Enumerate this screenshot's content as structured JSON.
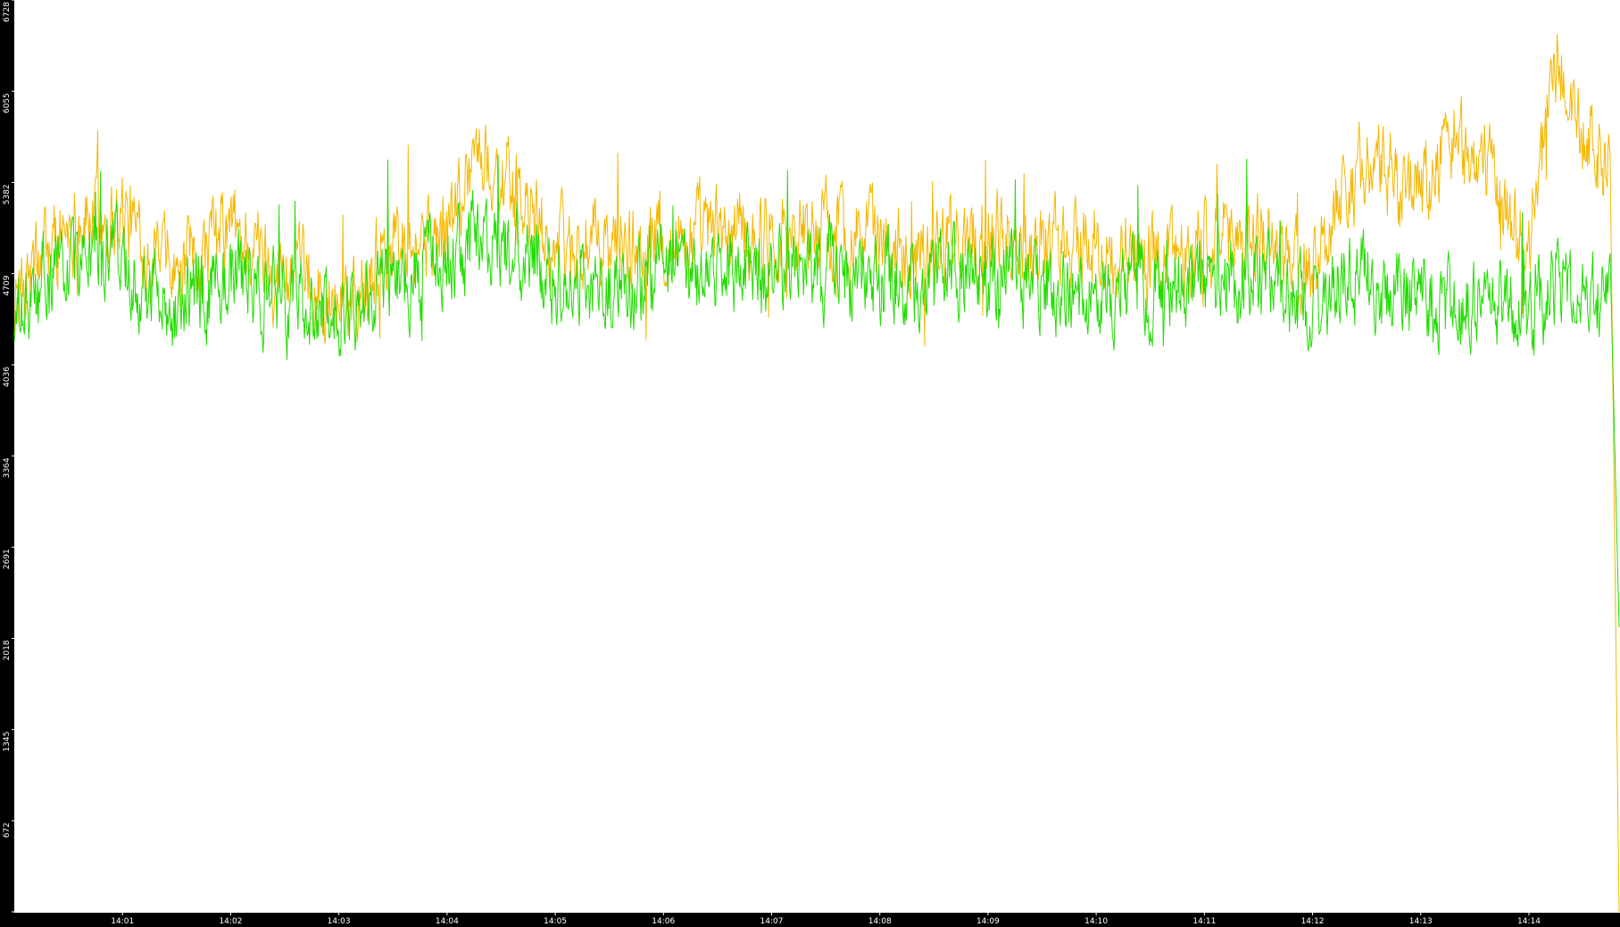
{
  "chart_data": {
    "type": "line",
    "title": "",
    "xlabel": "",
    "ylabel": "",
    "ylim": [
      0,
      6728
    ],
    "y_ticks": [
      "0",
      "672",
      "1345",
      "2018",
      "2691",
      "3364",
      "4036",
      "4709",
      "5382",
      "6055",
      "6728"
    ],
    "x_range": [
      "14:00:00",
      "14:14:50"
    ],
    "x_ticks": [
      "14:01",
      "14:02",
      "14:03",
      "14:04",
      "14:05",
      "14:06",
      "14:07",
      "14:08",
      "14:09",
      "14:10",
      "14:11",
      "14:12",
      "14:13",
      "14:14"
    ],
    "grid": false,
    "legend": "none",
    "background": "#ffffff",
    "axis_bar_color": "#000000",
    "series": [
      {
        "color": "#f5b800",
        "x": [
          "14:00",
          "14:00:30",
          "14:01",
          "14:01:30",
          "14:02",
          "14:02:30",
          "14:03",
          "14:03:30",
          "14:04",
          "14:04:15",
          "14:04:30",
          "14:05",
          "14:05:30",
          "14:06",
          "14:06:30",
          "14:07",
          "14:07:30",
          "14:08",
          "14:08:30",
          "14:09",
          "14:09:30",
          "14:10",
          "14:10:30",
          "14:11",
          "14:11:30",
          "14:12",
          "14:12:15",
          "14:12:30",
          "14:13",
          "14:13:15",
          "14:13:30",
          "14:14",
          "14:14:15",
          "14:14:30",
          "14:14:45",
          "14:14:50"
        ],
        "values": [
          4500,
          5100,
          5150,
          4650,
          5050,
          4700,
          4450,
          4950,
          5000,
          5650,
          5400,
          4900,
          4880,
          4950,
          5000,
          5000,
          5050,
          4950,
          4900,
          5000,
          4950,
          4900,
          4850,
          4950,
          5000,
          4700,
          5300,
          5500,
          5300,
          5700,
          5600,
          4900,
          6300,
          5700,
          5500,
          0
        ]
      },
      {
        "color": "#22dd00",
        "x": [
          "14:00",
          "14:00:30",
          "14:01",
          "14:01:30",
          "14:02",
          "14:02:30",
          "14:03",
          "14:03:30",
          "14:04",
          "14:04:15",
          "14:04:30",
          "14:05",
          "14:05:30",
          "14:06",
          "14:06:30",
          "14:07",
          "14:07:30",
          "14:08",
          "14:08:30",
          "14:09",
          "14:09:30",
          "14:10",
          "14:10:30",
          "14:11",
          "14:11:30",
          "14:12",
          "14:12:15",
          "14:12:30",
          "14:13",
          "14:13:15",
          "14:13:30",
          "14:14",
          "14:14:15",
          "14:14:30",
          "14:14:45",
          "14:14:50"
        ],
        "values": [
          4300,
          4800,
          4800,
          4450,
          4700,
          4500,
          4400,
          4700,
          4700,
          4950,
          4900,
          4650,
          4600,
          4700,
          4650,
          4650,
          4750,
          4650,
          4600,
          4700,
          4650,
          4600,
          4600,
          4650,
          4700,
          4450,
          4700,
          4650,
          4550,
          4450,
          4500,
          4350,
          4650,
          4550,
          4500,
          2100
        ]
      }
    ]
  }
}
